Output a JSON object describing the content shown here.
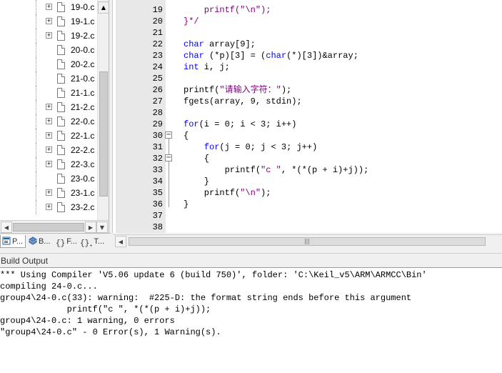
{
  "project_tree": {
    "items": [
      {
        "name": "19-0.c",
        "expandable": true
      },
      {
        "name": "19-1.c",
        "expandable": true
      },
      {
        "name": "19-2.c",
        "expandable": true
      },
      {
        "name": "20-0.c",
        "expandable": false
      },
      {
        "name": "20-2.c",
        "expandable": false
      },
      {
        "name": "21-0.c",
        "expandable": false
      },
      {
        "name": "21-1.c",
        "expandable": false
      },
      {
        "name": "21-2.c",
        "expandable": true
      },
      {
        "name": "22-0.c",
        "expandable": true
      },
      {
        "name": "22-1.c",
        "expandable": true
      },
      {
        "name": "22-2.c",
        "expandable": true
      },
      {
        "name": "22-3.c",
        "expandable": true
      },
      {
        "name": "23-0.c",
        "expandable": false
      },
      {
        "name": "23-1.c",
        "expandable": true
      },
      {
        "name": "23-2.c",
        "expandable": true
      }
    ]
  },
  "pane_tabs": [
    {
      "label": "P...",
      "icon": "project-icon",
      "active": true
    },
    {
      "label": "B...",
      "icon": "books-icon",
      "active": false
    },
    {
      "label": "F...",
      "icon": "functions-icon",
      "active": false
    },
    {
      "label": "T...",
      "icon": "templates-icon",
      "active": false
    }
  ],
  "editor": {
    "lines": [
      {
        "n": "19",
        "segs": [
          {
            "t": "    printf(",
            "c": "fn"
          },
          {
            "t": "\"\\n\"",
            "c": "st"
          },
          {
            "t": ");",
            "c": "fn"
          }
        ]
      },
      {
        "n": "20",
        "segs": [
          {
            "t": "}*/",
            "c": "fn"
          }
        ]
      },
      {
        "n": "21",
        "segs": []
      },
      {
        "n": "22",
        "segs": [
          {
            "t": "char",
            "c": "kw"
          },
          {
            "t": " array[",
            "c": ""
          },
          {
            "t": "9",
            "c": "nm"
          },
          {
            "t": "];",
            "c": ""
          }
        ]
      },
      {
        "n": "23",
        "segs": [
          {
            "t": "char",
            "c": "kw"
          },
          {
            "t": " (*p)[",
            "c": ""
          },
          {
            "t": "3",
            "c": "nm"
          },
          {
            "t": "] = (",
            "c": ""
          },
          {
            "t": "char",
            "c": "kw"
          },
          {
            "t": "(*)[",
            "c": ""
          },
          {
            "t": "3",
            "c": "nm"
          },
          {
            "t": "])&array;",
            "c": ""
          }
        ]
      },
      {
        "n": "24",
        "segs": [
          {
            "t": "int",
            "c": "kw"
          },
          {
            "t": " i, j;",
            "c": ""
          }
        ]
      },
      {
        "n": "25",
        "segs": []
      },
      {
        "n": "26",
        "segs": [
          {
            "t": "printf(",
            "c": ""
          },
          {
            "t": "\"请输入字符：\"",
            "c": "st"
          },
          {
            "t": ");",
            "c": ""
          }
        ]
      },
      {
        "n": "27",
        "segs": [
          {
            "t": "fgets(array, ",
            "c": ""
          },
          {
            "t": "9",
            "c": "nm"
          },
          {
            "t": ", stdin);",
            "c": ""
          }
        ]
      },
      {
        "n": "28",
        "segs": []
      },
      {
        "n": "29",
        "segs": [
          {
            "t": "for",
            "c": "kw"
          },
          {
            "t": "(i = ",
            "c": ""
          },
          {
            "t": "0",
            "c": "nm"
          },
          {
            "t": "; i < ",
            "c": ""
          },
          {
            "t": "3",
            "c": "nm"
          },
          {
            "t": "; i++)",
            "c": ""
          }
        ]
      },
      {
        "n": "30",
        "segs": [
          {
            "t": "{",
            "c": ""
          }
        ]
      },
      {
        "n": "31",
        "segs": [
          {
            "t": "    ",
            "c": ""
          },
          {
            "t": "for",
            "c": "kw"
          },
          {
            "t": "(j = ",
            "c": ""
          },
          {
            "t": "0",
            "c": "nm"
          },
          {
            "t": "; j < ",
            "c": ""
          },
          {
            "t": "3",
            "c": "nm"
          },
          {
            "t": "; j++)",
            "c": ""
          }
        ]
      },
      {
        "n": "32",
        "segs": [
          {
            "t": "    {",
            "c": ""
          }
        ]
      },
      {
        "n": "33",
        "segs": [
          {
            "t": "        printf(",
            "c": ""
          },
          {
            "t": "\"c \"",
            "c": "st"
          },
          {
            "t": ", *(*(p + i)+j));",
            "c": ""
          }
        ]
      },
      {
        "n": "34",
        "segs": [
          {
            "t": "    }",
            "c": ""
          }
        ]
      },
      {
        "n": "35",
        "segs": [
          {
            "t": "    printf(",
            "c": ""
          },
          {
            "t": "\"\\n\"",
            "c": "st"
          },
          {
            "t": ");",
            "c": ""
          }
        ]
      },
      {
        "n": "36",
        "segs": [
          {
            "t": "}",
            "c": ""
          }
        ]
      },
      {
        "n": "37",
        "segs": []
      },
      {
        "n": "38",
        "segs": []
      }
    ]
  },
  "build_output": {
    "title": "Build Output",
    "lines": [
      "*** Using Compiler 'V5.06 update 6 (build 750)', folder: 'C:\\Keil_v5\\ARM\\ARMCC\\Bin'",
      "compiling 24-0.c...",
      "group4\\24-0.c(33): warning:  #225-D: the format string ends before this argument",
      "             printf(\"c \", *(*(p + i)+j));",
      "group4\\24-0.c: 1 warning, 0 errors",
      "\"group4\\24-0.c\" - 0 Error(s), 1 Warning(s)."
    ]
  },
  "colors": {
    "keyword": "#0000ff",
    "string": "#800080",
    "gutter": "#e8e8e8"
  }
}
